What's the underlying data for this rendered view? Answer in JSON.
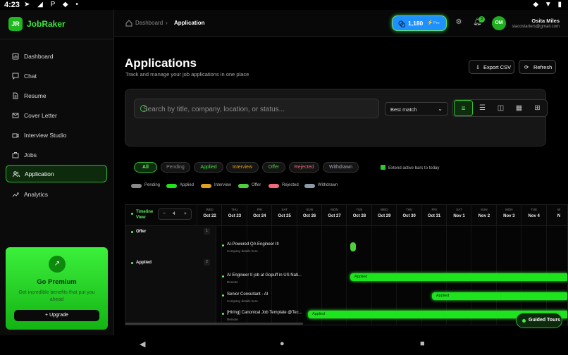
{
  "status_bar": {
    "time": "4:23",
    "left_icons": "➤ ◢ P ◆ •",
    "right_icons": "◆ ▼ ▮"
  },
  "app": {
    "logo_initials": "JR",
    "name": "JobRaker"
  },
  "sidebar": {
    "items": [
      {
        "label": "Dashboard",
        "icon": "dashboard-icon"
      },
      {
        "label": "Chat",
        "icon": "chat-icon"
      },
      {
        "label": "Resume",
        "icon": "resume-icon"
      },
      {
        "label": "Cover Letter",
        "icon": "cover-letter-icon"
      },
      {
        "label": "Interview Studio",
        "icon": "video-icon"
      },
      {
        "label": "Jobs",
        "icon": "briefcase-icon"
      },
      {
        "label": "Application",
        "icon": "users-icon"
      },
      {
        "label": "Analytics",
        "icon": "trend-icon"
      }
    ],
    "active_index": 6,
    "premium": {
      "title": "Go Premium",
      "subtitle": "Get incredible benefits that put you ahead",
      "button": "Upgrade"
    }
  },
  "topbar": {
    "breadcrumb": [
      "Dashboard",
      "Application"
    ],
    "credits": "1,180",
    "credits_tag": "Pro",
    "notification_count": "3",
    "avatar_initials": "OM",
    "user_name": "Osita Miles",
    "user_email": "siacostarters@gmail.com"
  },
  "page": {
    "title": "Applications",
    "subtitle": "Track and manage your job applications in one place",
    "export_label": "Export CSV",
    "refresh_label": "Refresh"
  },
  "filters": {
    "search_placeholder": "Search by title, company, location, or status...",
    "sort_value": "Best match",
    "chips": [
      "All",
      "Pending",
      "Applied",
      "Interview",
      "Offer",
      "Rejected",
      "Withdrawn"
    ],
    "extend_label": "Extend active bars to today"
  },
  "legend": [
    {
      "label": "Pending",
      "color": "#8a8a8a"
    },
    {
      "label": "Applied",
      "color": "#1de41d"
    },
    {
      "label": "Interview",
      "color": "#e0a020"
    },
    {
      "label": "Offer",
      "color": "#4fcf3f"
    },
    {
      "label": "Rejected",
      "color": "#f06a7a"
    },
    {
      "label": "Withdrawn",
      "color": "#8a9aaa"
    }
  ],
  "timeline": {
    "label": "Timeline View",
    "zoom": "4",
    "days": [
      {
        "dow": "WED",
        "date": "Oct 22"
      },
      {
        "dow": "THU",
        "date": "Oct 23"
      },
      {
        "dow": "FRI",
        "date": "Oct 24"
      },
      {
        "dow": "SAT",
        "date": "Oct 25"
      },
      {
        "dow": "SUN",
        "date": "Oct 26"
      },
      {
        "dow": "MON",
        "date": "Oct 27"
      },
      {
        "dow": "TUE",
        "date": "Oct 28"
      },
      {
        "dow": "WED",
        "date": "Oct 29"
      },
      {
        "dow": "THU",
        "date": "Oct 30"
      },
      {
        "dow": "FRI",
        "date": "Oct 31"
      },
      {
        "dow": "SAT",
        "date": "Nov 1"
      },
      {
        "dow": "SUN",
        "date": "Nov 2"
      },
      {
        "dow": "MON",
        "date": "Nov 3"
      },
      {
        "dow": "TUE",
        "date": "Nov 4"
      },
      {
        "dow": "W",
        "date": "N"
      }
    ],
    "groups": [
      {
        "name": "Offer",
        "count": "1"
      },
      {
        "name": "Applied",
        "count": "2"
      }
    ],
    "rows": [
      {
        "title": "AI-Powered QA Engineer III",
        "sub": "Company details here"
      },
      {
        "title": "AI Engineer II job at Gopuff in US Nati...",
        "sub": "Remote",
        "bar": "Applied"
      },
      {
        "title": "Senior Consultant - AI",
        "sub": "Company details here",
        "bar": "Applied"
      },
      {
        "title": "[Hiring] Canonical Job Template @Tec...",
        "sub": "Remote",
        "bar": "Applied"
      }
    ]
  },
  "guided_tours": "Guided Tours",
  "android_nav": {
    "back": "◀",
    "home": "●",
    "recents": "■"
  }
}
